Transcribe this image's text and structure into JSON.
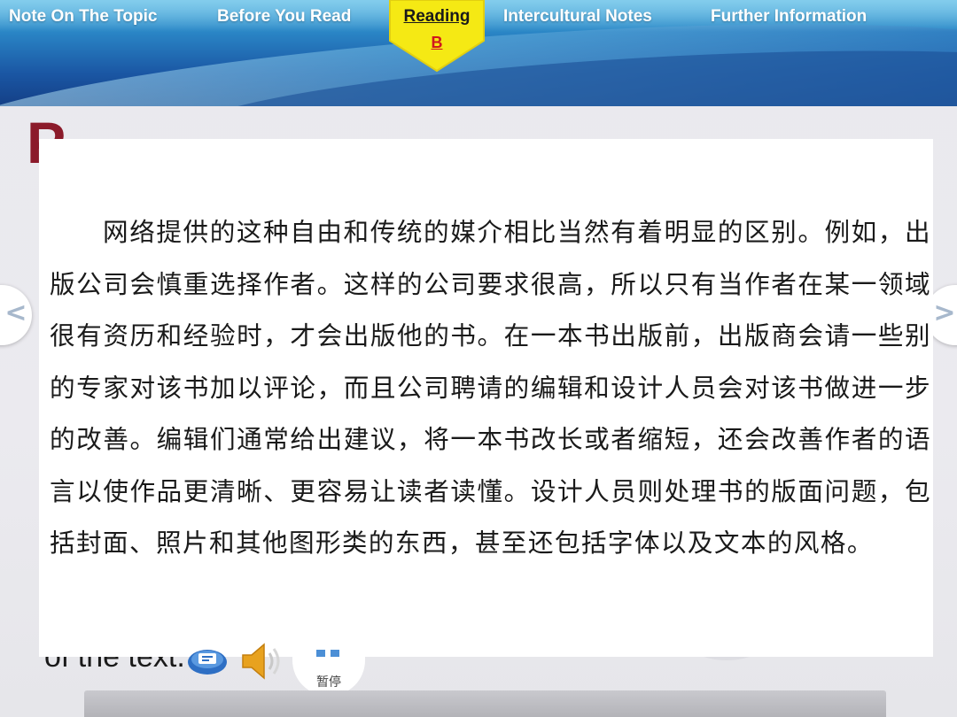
{
  "nav": {
    "items": [
      "Note On The Topic",
      "Before You Read",
      "Intercultural Notes",
      "Further Information"
    ],
    "active": {
      "label": "Reading",
      "sub_label": "B"
    }
  },
  "slide": {
    "heading_letter": "P",
    "background_text": "of the text."
  },
  "panel": {
    "paragraph": "网络提供的这种自由和传统的媒介相比当然有着明显的区别。例如，出版公司会慎重选择作者。这样的公司要求很高，所以只有当作者在某一领域很有资历和经验时，才会出版他的书。在一本书出版前，出版商会请一些别的专家对该书加以评论，而且公司聘请的编辑和设计人员会对该书做进一步的改善。编辑们通常给出建议，将一本书改长或者缩短，还会改善作者的语言以使作品更清晰、更容易让读者读懂。设计人员则处理书的版面问题，包括封面、照片和其他图形类的东西，甚至还包括字体以及文本的风格。"
  },
  "controls": {
    "pause_label": "暂停",
    "prev_glyph": "<",
    "next_glyph": ">"
  },
  "colors": {
    "active_tab_fill": "#f5e914",
    "active_sub_label": "#d0171e",
    "heading_letter": "#8b1a2a",
    "banner_deep": "#143f86",
    "arrow_glyph": "#a7b8cc"
  },
  "icons": [
    "translate-icon",
    "speaker-icon",
    "pause-icon",
    "prev-arrow-icon",
    "next-arrow-icon"
  ]
}
